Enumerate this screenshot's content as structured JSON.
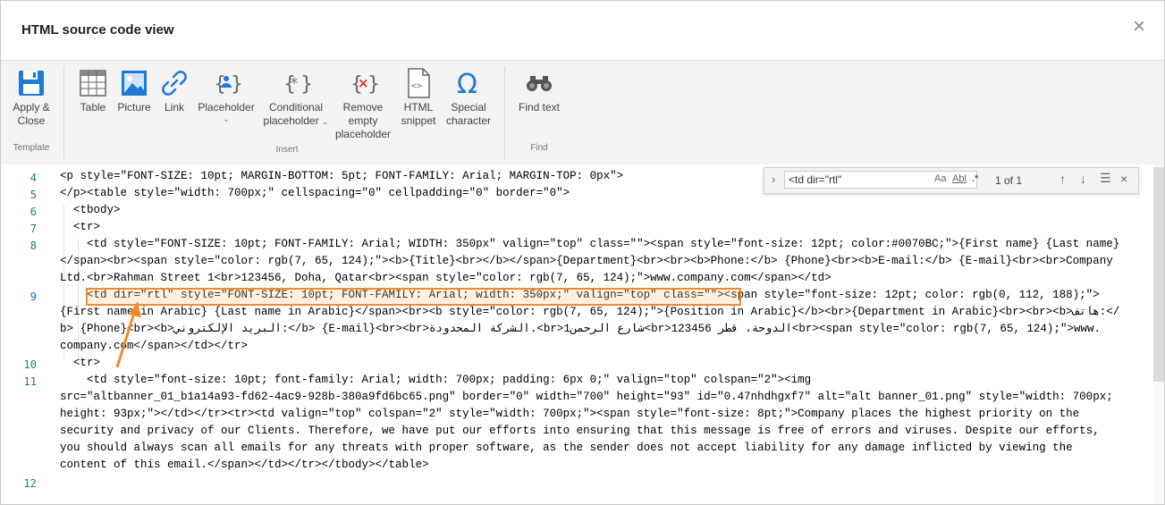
{
  "dialog": {
    "title": "HTML source code view",
    "close_label": "×"
  },
  "ribbon": {
    "groups": [
      {
        "label": "Template"
      },
      {
        "label": "Insert"
      },
      {
        "label": "Find"
      }
    ],
    "buttons": {
      "apply_close": "Apply & Close",
      "table": "Table",
      "picture": "Picture",
      "link": "Link",
      "placeholder": "Placeholder",
      "conditional_placeholder": "Conditional placeholder",
      "remove_empty_placeholder": "Remove empty placeholder",
      "html_snippet": "HTML snippet",
      "special_character": "Special character",
      "find_text": "Find text"
    },
    "icons": {
      "apply_close": "floppy-disk-icon",
      "table": "table-icon",
      "picture": "picture-icon",
      "link": "link-icon",
      "placeholder": "placeholder-icon",
      "conditional_placeholder": "conditional-placeholder-icon",
      "remove_empty_placeholder": "remove-placeholder-icon",
      "html_snippet": "html-file-icon",
      "special_character": "omega-icon",
      "find_text": "binoculars-icon"
    },
    "accent_color": "#1e7ad4",
    "remove_color": "#d9302c"
  },
  "find": {
    "query": "<td dir=\"rtl\"",
    "match_case": "Aa",
    "whole_word": "Abl",
    "regex": ".*",
    "count": "1 of 1"
  },
  "code": {
    "line_numbers": [
      "4",
      "5",
      "6",
      "7",
      "8",
      "9",
      "10",
      "11",
      "12"
    ],
    "lines": [
      "<p style=\"FONT-SIZE: 10pt; MARGIN-BOTTOM: 5pt; FONT-FAMILY: Arial; MARGIN-TOP: 0px\">",
      "</p><table style=\"width: 700px;\" cellspacing=\"0\" cellpadding=\"0\" border=\"0\">",
      "  <tbody>",
      "  <tr>",
      "    <td style=\"FONT-SIZE: 10pt; FONT-FAMILY: Arial; WIDTH: 350px\" valign=\"top\" class=\"\"><span style=\"font-size: 12pt; color:#0070BC;\">{First name} {Last name}",
      "</span><br><span style=\"color: rgb(7, 65, 124);\"><b>{Title}<br></b></span>{Department}<br><br><b>Phone:</b> {Phone}<br><b>E-mail:</b> {E-mail}<br><br>Company",
      "Ltd.<br>Rahman Street 1<br>123456, Doha, Qatar<br><span style=\"color: rgb(7, 65, 124);\">www.company.com</span></td>",
      "    <td dir=\"rtl\" style=\"FONT-SIZE: 10pt; FONT-FAMILY: Arial; width: 350px;\" valign=\"top\" class=\"\"><span style=\"font-size: 12pt; color: rgb(0, 112, 188);\">",
      "{First name in Arabic} {Last name in Arabic}</span><br><b style=\"color: rgb(7, 65, 124);\">{Position in Arabic}</b><br>{Department in Arabic}<br><br><b>هاتف:</",
      "b> {Phone}<br><b>البريد الإلكتروني:</b> {E-mail}<br><br>الشركة المحدودة.<br>1شارع الرحمن<br>123456 الدوحة، قطر<br><span style=\"color: rgb(7, 65, 124);\">www.",
      "company.com</span></td></tr>",
      "  <tr>",
      "    <td style=\"font-size: 10pt; font-family: Arial; width: 700px; padding: 6px 0;\" valign=\"top\" colspan=\"2\"><img",
      "src=\"altbanner_01_b1a14a93-fd62-4ac9-928b-380a9fd6bc65.png\" border=\"0\" width=\"700\" height=\"93\" id=\"0.47nhdhgxf7\" alt=\"alt banner_01.png\" style=\"width: 700px;",
      "height: 93px;\"></td></tr><tr><td valign=\"top\" colspan=\"2\" style=\"width: 700px;\"><span style=\"font-size: 8pt;\">Company places the highest priority on the",
      "security and privacy of our Clients. Therefore, we have put our efforts into ensuring that this message is free of errors and viruses. Despite our efforts,",
      "you should always scan all emails for any threats with proper software, as the sender does not accept liability for any damage inflicted by viewing the",
      "content of this email.</span></td></tr></tbody></table>"
    ]
  },
  "highlight_color": "#f08b2c"
}
